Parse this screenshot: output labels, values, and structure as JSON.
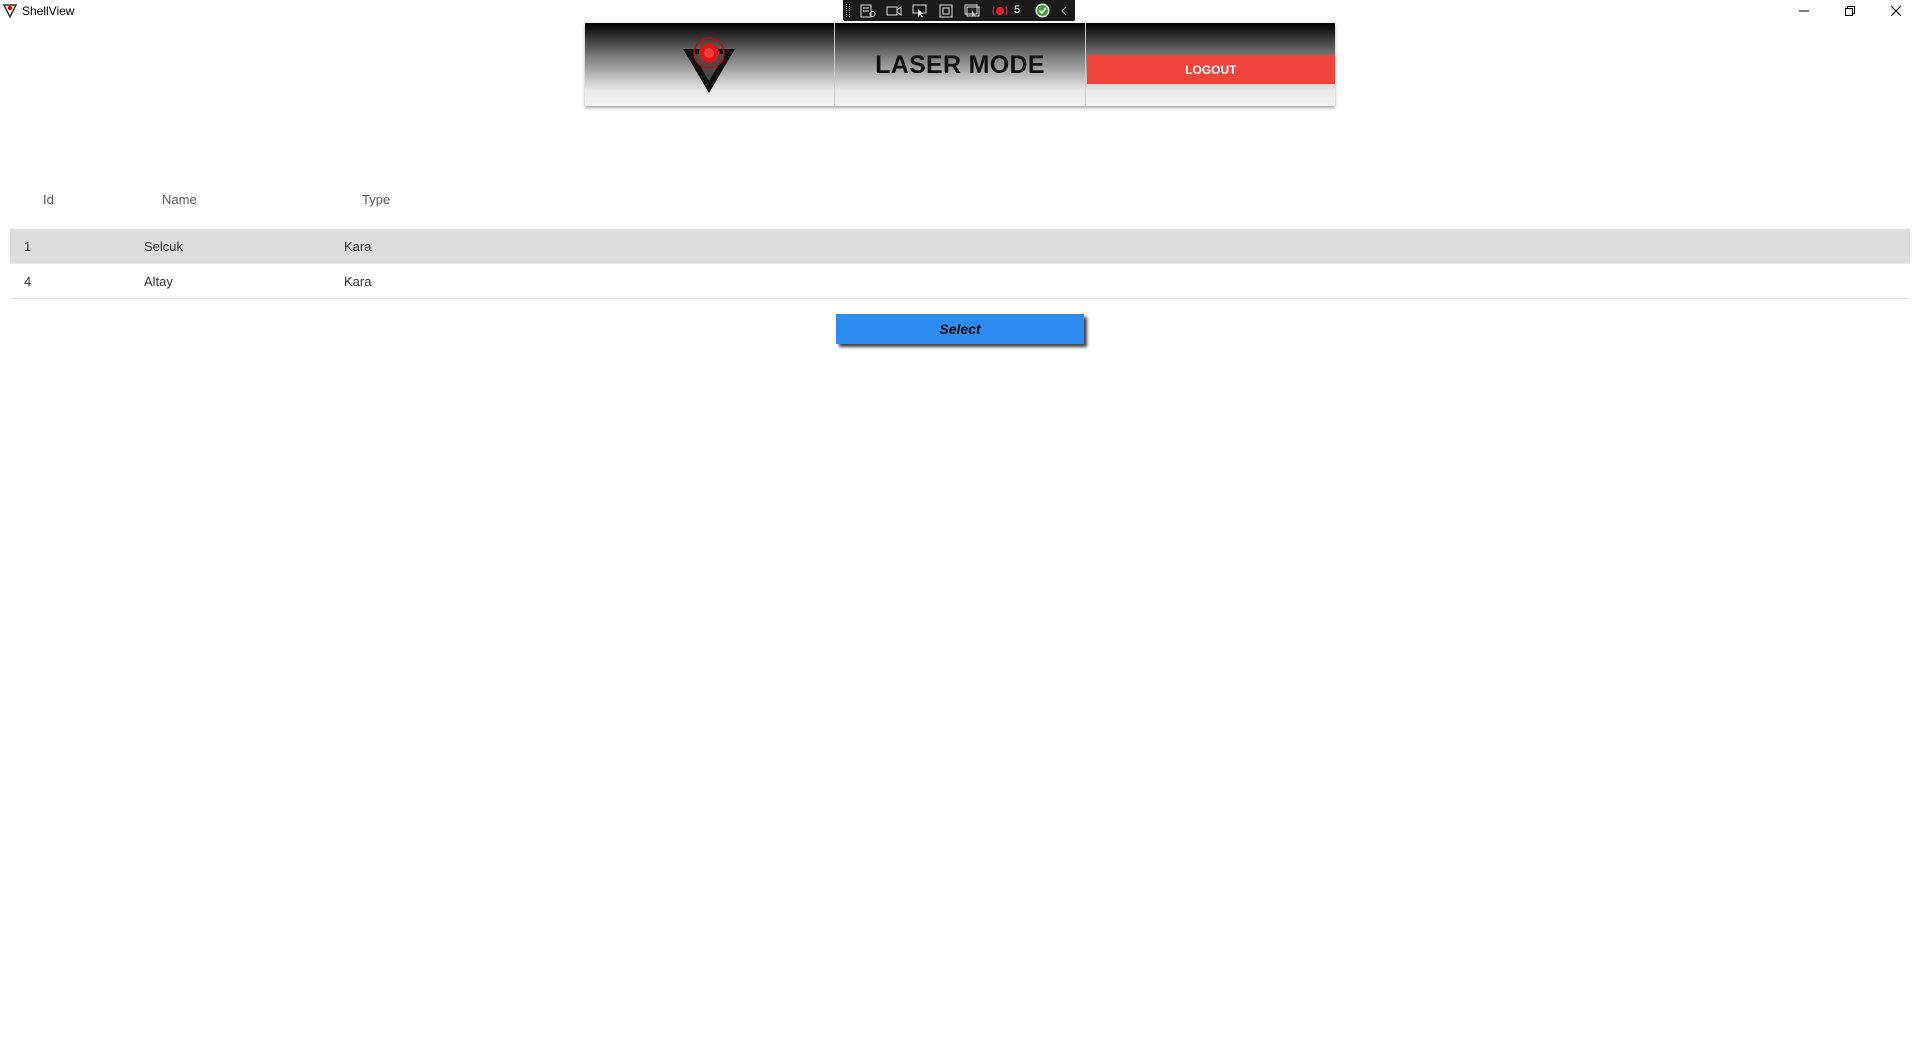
{
  "window": {
    "title": "ShellView",
    "minimize_icon": "minimize-icon",
    "restore_icon": "restore-icon",
    "close_icon": "close-icon"
  },
  "toolbar": {
    "icons": [
      "settings-panel-icon",
      "camera-icon",
      "pointer-icon",
      "frame-select-icon",
      "screen-pointer-icon",
      "alerts-icon",
      "check-icon",
      "chevron-left-icon"
    ],
    "alert_count": "5",
    "accent_color": "#1b1b1b"
  },
  "header": {
    "mode_title": "LASER MODE",
    "logout_label": "LOGOUT",
    "logout_color": "#f0443b"
  },
  "grid": {
    "columns": [
      "Id",
      "Name",
      "Type"
    ],
    "rows": [
      {
        "id": "1",
        "name": "Selcuk",
        "type": "Kara",
        "selected": true
      },
      {
        "id": "4",
        "name": "Altay",
        "type": "Kara",
        "selected": false
      }
    ]
  },
  "actions": {
    "select_label": "Select",
    "select_color": "#2e8bf0"
  }
}
